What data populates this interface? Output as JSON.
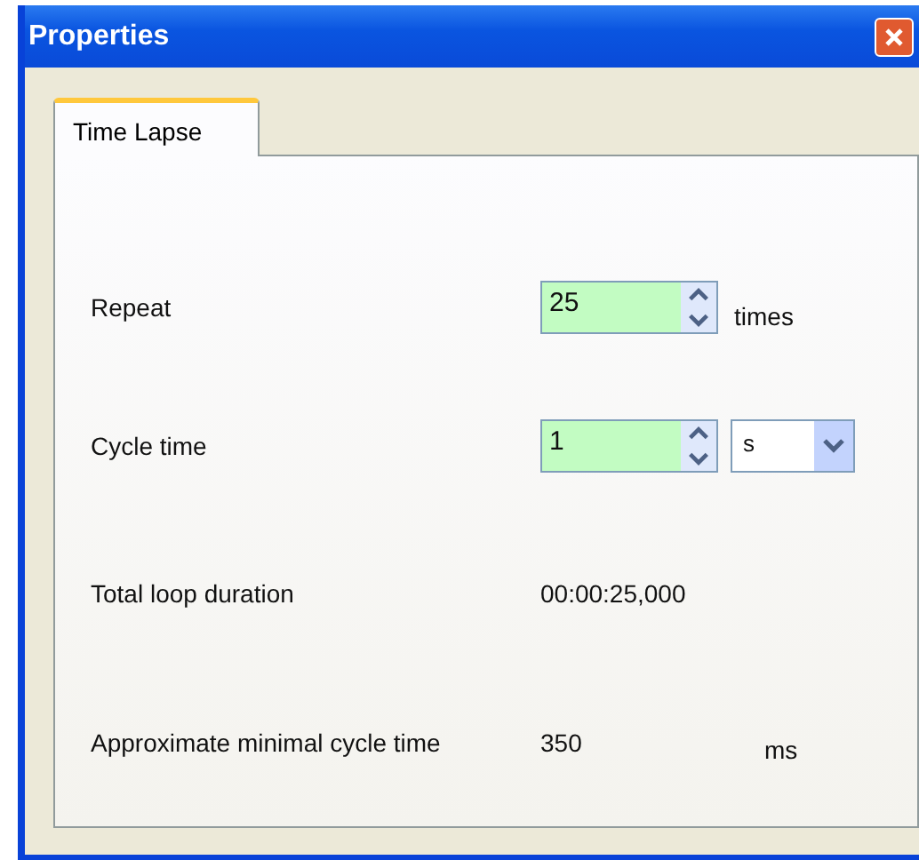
{
  "window": {
    "title": "Properties"
  },
  "tabs": [
    {
      "label": "Time Lapse",
      "selected": true
    }
  ],
  "fields": [
    {
      "kind": "spin",
      "label": "Repeat",
      "value": "25",
      "unit": "times"
    },
    {
      "kind": "spin-select",
      "label": "Cycle time",
      "value": "1",
      "unit": "s"
    },
    {
      "kind": "readout",
      "label": "Total loop duration",
      "value": "00:00:25,000"
    },
    {
      "kind": "readout",
      "label": "Approximate minimal cycle time",
      "value": "350",
      "unit": "ms"
    }
  ]
}
